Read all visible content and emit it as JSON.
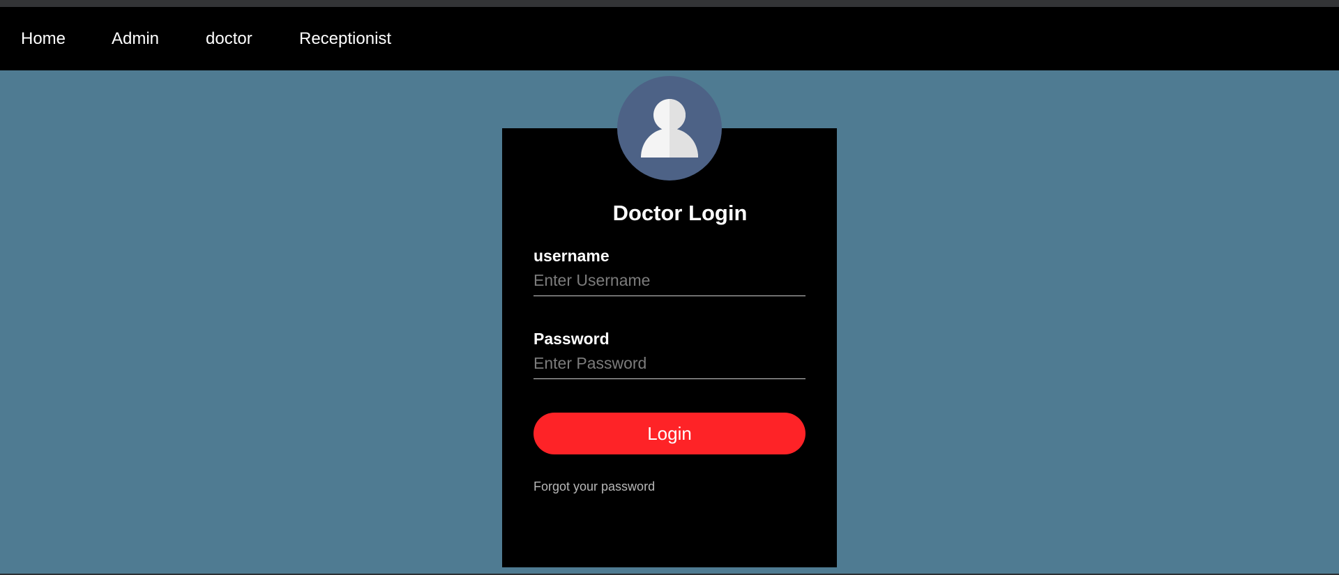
{
  "nav": {
    "items": [
      {
        "label": "Home"
      },
      {
        "label": "Admin"
      },
      {
        "label": "doctor"
      },
      {
        "label": "Receptionist"
      }
    ]
  },
  "login": {
    "avatar_icon": "user-avatar-icon",
    "title": "Doctor Login",
    "username": {
      "label": "username",
      "placeholder": "Enter Username",
      "value": ""
    },
    "password": {
      "label": "Password",
      "placeholder": "Enter Password",
      "value": ""
    },
    "submit_label": "Login",
    "forgot_label": "Forgot your password"
  },
  "colors": {
    "page_background": "#4f7b92",
    "navbar_background": "#000000",
    "card_background": "#000000",
    "avatar_background": "#4d6286",
    "button_background": "#fe2327",
    "link_color": "#b8b8b8"
  }
}
